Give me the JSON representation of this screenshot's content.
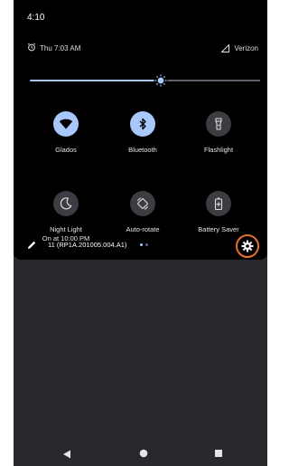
{
  "status_bar": {
    "time": "4:10"
  },
  "info_line": {
    "alarm_text": "Thu 7:03 AM",
    "carrier": "Verizon"
  },
  "brightness": {
    "level": 0.6
  },
  "tiles": [
    {
      "label": "Glados",
      "sub": "",
      "active": true,
      "icon": "wifi-icon"
    },
    {
      "label": "Bluetooth",
      "sub": "",
      "active": true,
      "icon": "bluetooth-icon"
    },
    {
      "label": "Flashlight",
      "sub": "",
      "active": false,
      "icon": "flashlight-icon"
    },
    {
      "label": "Night Light",
      "sub": "On at 10:00 PM",
      "active": false,
      "icon": "night-light-icon"
    },
    {
      "label": "Auto-rotate",
      "sub": "",
      "active": false,
      "icon": "auto-rotate-icon"
    },
    {
      "label": "Battery Saver",
      "sub": "",
      "active": false,
      "icon": "battery-saver-icon"
    }
  ],
  "build": {
    "text": "11 (RP1A.201005.004.A1)"
  },
  "colors": {
    "active_tile": "#a8c7fa",
    "inactive_tile": "#3b3d42",
    "highlight_ring": "#e8712a",
    "page_dot_active": "#a8c7fa",
    "page_dot_inactive": "#5b6b8c"
  }
}
